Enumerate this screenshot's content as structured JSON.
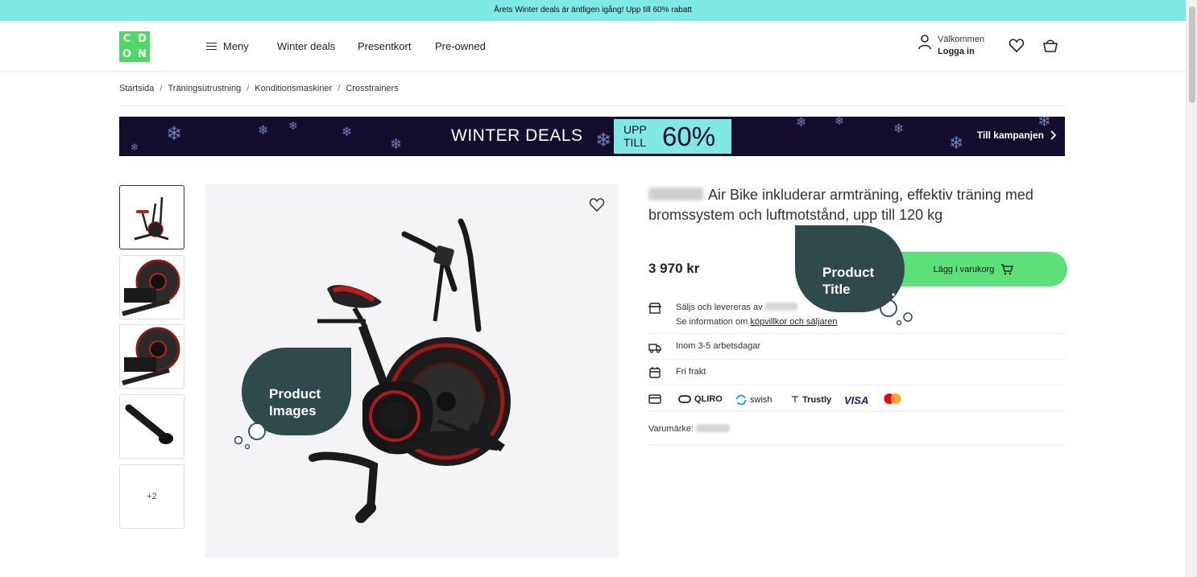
{
  "promo": {
    "text": "Årets Winter deals är äntligen igång! Upp till 60% rabatt"
  },
  "header": {
    "logo_letters": [
      "C",
      "D",
      "O",
      "N"
    ],
    "menu_label": "Meny",
    "nav": [
      "Winter deals",
      "Presentkort",
      "Pre-owned"
    ],
    "account_greeting": "Välkommen",
    "account_login": "Logga in",
    "icons": [
      "user-icon",
      "heart-icon",
      "cart-icon"
    ]
  },
  "breadcrumb": [
    "Startsida",
    "Träningsutrustning",
    "Konditionsmaskiner",
    "Crosstrainers"
  ],
  "banner": {
    "title": "WINTER DEALS",
    "badge_top": "UPP",
    "badge_bottom": "TILL",
    "badge_percent": "60%",
    "cta": "Till kampanjen",
    "colors": {
      "background": "#140d2e",
      "badge": "#7eeae3"
    }
  },
  "gallery": {
    "more_label": "+2"
  },
  "product": {
    "title": "Air Bike inkluderar armträning, effektiv träning med bromssystem och luftmotstånd, upp till 120 kg",
    "price": "3 970 kr",
    "add_to_cart": "Lägg i varukorg",
    "seller_line": "Säljs och levereras av",
    "info_line_prefix": "Se information om",
    "info_link": "köpvillkor och säljaren",
    "delivery": "Inom 3-5 arbetsdagar",
    "shipping": "Fri frakt",
    "brand_label": "Varumärke:",
    "payment_methods": [
      "QLIRO",
      "swish",
      "Trustly",
      "VISA"
    ]
  },
  "annotations": {
    "images_line1": "Product",
    "images_line2": "Images",
    "title_line1": "Product",
    "title_line2": "Title"
  },
  "colors": {
    "accent_green": "#5ce07a",
    "promo_teal": "#7eeae3",
    "bubble": "#2e4a4a"
  }
}
